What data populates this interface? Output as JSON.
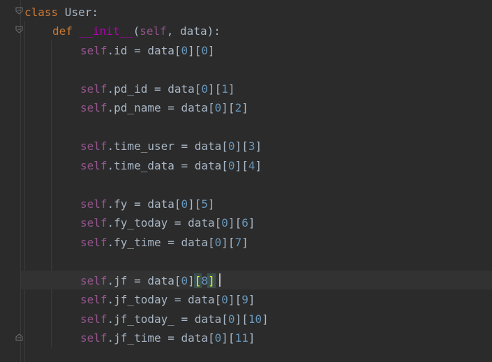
{
  "editor": {
    "language": "Python",
    "colors": {
      "background": "#2b2b2b",
      "keyword": "#cc7832",
      "self": "#94558d",
      "dunder": "#b200b2",
      "number": "#6897bb",
      "text": "#a9b7c6",
      "bracket_highlight": "#ffef28"
    },
    "lines": [
      {
        "parts": [
          "class",
          " User:"
        ]
      },
      {
        "parts": [
          "def",
          " ",
          "__init__",
          "(",
          "self",
          ", data):"
        ]
      },
      {
        "parts": [
          "self",
          ".id = data[",
          "0",
          "][",
          "0",
          "]"
        ]
      },
      {
        "parts": [
          "self",
          ".pd_id = data[",
          "0",
          "][",
          "1",
          "]"
        ]
      },
      {
        "parts": [
          "self",
          ".pd_name = data[",
          "0",
          "][",
          "2",
          "]"
        ]
      },
      {
        "parts": [
          "self",
          ".time_user = data[",
          "0",
          "][",
          "3",
          "]"
        ]
      },
      {
        "parts": [
          "self",
          ".time_data = data[",
          "0",
          "][",
          "4",
          "]"
        ]
      },
      {
        "parts": [
          "self",
          ".fy = data[",
          "0",
          "][",
          "5",
          "]"
        ]
      },
      {
        "parts": [
          "self",
          ".fy_today = data[",
          "0",
          "][",
          "6",
          "]"
        ]
      },
      {
        "parts": [
          "self",
          ".fy_time = data[",
          "0",
          "][",
          "7",
          "]"
        ]
      },
      {
        "parts": [
          "self",
          ".jf = data[",
          "0",
          "]",
          "[",
          "8",
          "]"
        ]
      },
      {
        "parts": [
          "self",
          ".jf_today = data[",
          "0",
          "][",
          "9",
          "]"
        ]
      },
      {
        "parts": [
          "self",
          ".jf_today_ = data[",
          "0",
          "][",
          "10",
          "]"
        ]
      },
      {
        "parts": [
          "self",
          ".jf_time = data[",
          "0",
          "][",
          "11",
          "]"
        ]
      }
    ]
  }
}
